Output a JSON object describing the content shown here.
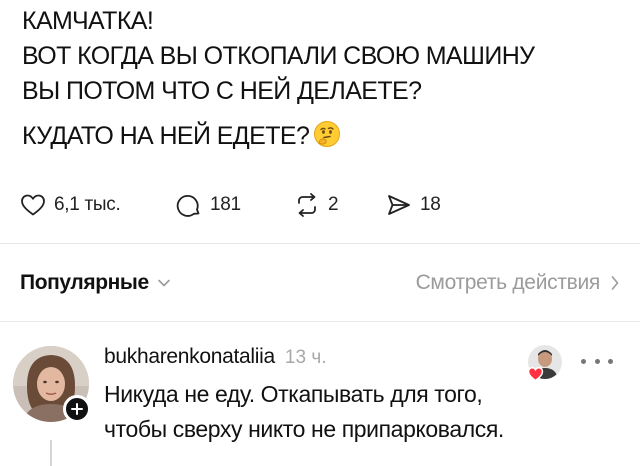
{
  "post": {
    "lines": [
      "КАМЧАТКА!",
      "ВОТ КОГДА ВЫ ОТКОПАЛИ СВОЮ МАШИНУ",
      "ВЫ ПОТОМ ЧТО С НЕЙ ДЕЛАЕТЕ?",
      "КУДАТО НА НЕЙ ЕДЕТЕ?"
    ],
    "emoji_icon": "thinking-face-emoji"
  },
  "actions": {
    "likes": "6,1 тыс.",
    "replies": "181",
    "reposts": "2",
    "shares": "18",
    "icons": [
      "heart-icon",
      "comment-bubble-icon",
      "repost-icon",
      "send-icon"
    ]
  },
  "filter": {
    "label": "Популярные",
    "activity_link": "Смотреть действия",
    "icons": [
      "chevron-down-icon",
      "chevron-right-icon"
    ]
  },
  "comment": {
    "username": "bukharenkonataliia",
    "time": "13 ч.",
    "text_lines": [
      "Никуда не еду. Откапывать для того,",
      "чтобы сверху никто не припарковался."
    ],
    "icons": [
      "avatar",
      "follow-plus-icon",
      "liked-by-author-avatar",
      "heart-icon",
      "more-icon"
    ]
  },
  "colors": {
    "text": "#111111",
    "secondary": "#9b9b9b",
    "divider": "#e8e8e8",
    "like_red": "#ff3040"
  }
}
